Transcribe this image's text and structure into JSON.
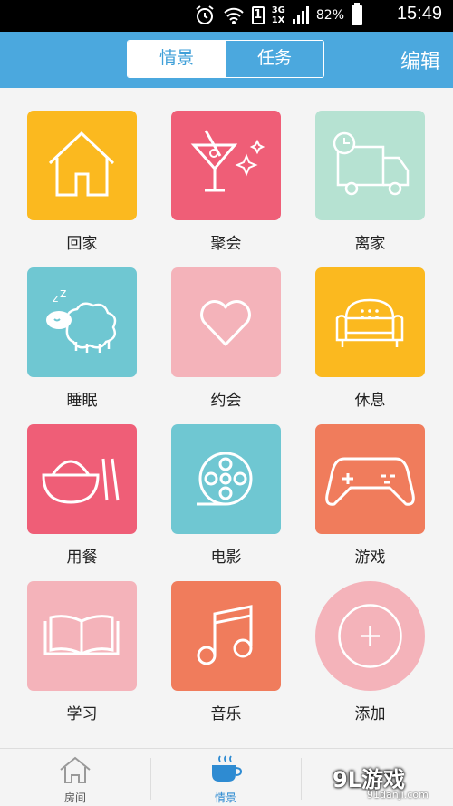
{
  "status_bar": {
    "time": "15:49",
    "battery": "82%",
    "sim": "1",
    "network_top": "3G",
    "network_bottom": "1X"
  },
  "header": {
    "tab_active": "情景",
    "tab_inactive": "任务",
    "edit_label": "编辑"
  },
  "scenes": [
    {
      "label": "回家",
      "icon": "house-icon",
      "color": "#fbb91f"
    },
    {
      "label": "聚会",
      "icon": "cocktail-icon",
      "color": "#ef5e77"
    },
    {
      "label": "离家",
      "icon": "truck-clock-icon",
      "color": "#b6e2d2"
    },
    {
      "label": "睡眠",
      "icon": "sleeping-sheep-icon",
      "color": "#6fc7d2"
    },
    {
      "label": "约会",
      "icon": "heart-icon",
      "color": "#f4b3ba"
    },
    {
      "label": "休息",
      "icon": "sofa-icon",
      "color": "#fbb91f"
    },
    {
      "label": "用餐",
      "icon": "bowl-chopsticks-icon",
      "color": "#ef5e77"
    },
    {
      "label": "电影",
      "icon": "film-reel-icon",
      "color": "#6fc7d2"
    },
    {
      "label": "游戏",
      "icon": "gamepad-icon",
      "color": "#f07c5c"
    },
    {
      "label": "学习",
      "icon": "open-book-icon",
      "color": "#f4b3ba"
    },
    {
      "label": "音乐",
      "icon": "music-note-icon",
      "color": "#f07c5c"
    },
    {
      "label": "添加",
      "icon": "plus-icon",
      "color": "#f4b3ba"
    }
  ],
  "bottom_nav": {
    "items": [
      {
        "label": "房间",
        "icon": "house-outline-icon"
      },
      {
        "label": "情景",
        "icon": "coffee-cup-icon"
      }
    ]
  },
  "watermark": {
    "main": "9L游戏",
    "sub": "91danji.com"
  }
}
